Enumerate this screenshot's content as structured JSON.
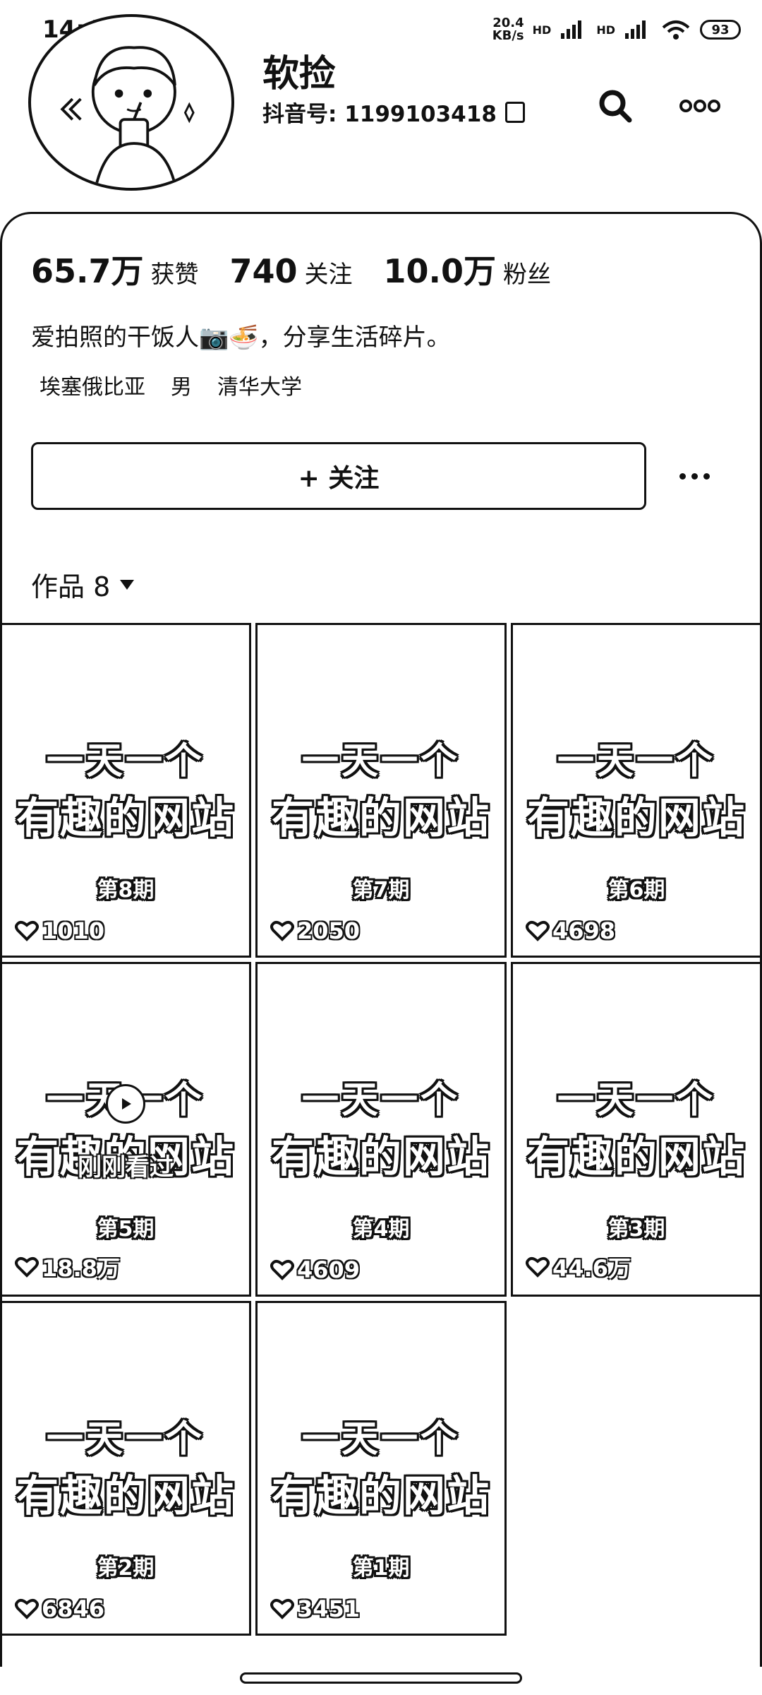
{
  "status_bar": {
    "time": "14:43",
    "net_speed_value": "20.4",
    "net_speed_unit": "KB/s",
    "network_1": "HD",
    "network_2": "HD",
    "battery": "93"
  },
  "profile": {
    "name": "软捡",
    "douyin_id": "抖音号: 1199103418"
  },
  "stats": [
    {
      "value": "65.7万",
      "label": "获赞"
    },
    {
      "value": "740",
      "label": "关注"
    },
    {
      "value": "10.0万",
      "label": "粉丝"
    }
  ],
  "bio": "爱拍照的干饭人📷🍜，分享生活碎片。",
  "tags": [
    "埃塞俄比亚",
    "男",
    "清华大学"
  ],
  "follow_button": {
    "label": "+ 关注"
  },
  "works": {
    "label": "作品 8"
  },
  "video_title_line1": "一天一个",
  "video_title_line2": "有趣的网站",
  "watched_label": "刚刚看过",
  "videos": [
    {
      "episode": "第8期",
      "likes": "1010"
    },
    {
      "episode": "第7期",
      "likes": "2050"
    },
    {
      "episode": "第6期",
      "likes": "4698"
    },
    {
      "episode": "第5期",
      "likes": "18.8万"
    },
    {
      "episode": "第4期",
      "likes": "4609"
    },
    {
      "episode": "第3期",
      "likes": "44.6万"
    },
    {
      "episode": "第2期",
      "likes": "6846"
    },
    {
      "episode": "第1期",
      "likes": "3451"
    }
  ]
}
